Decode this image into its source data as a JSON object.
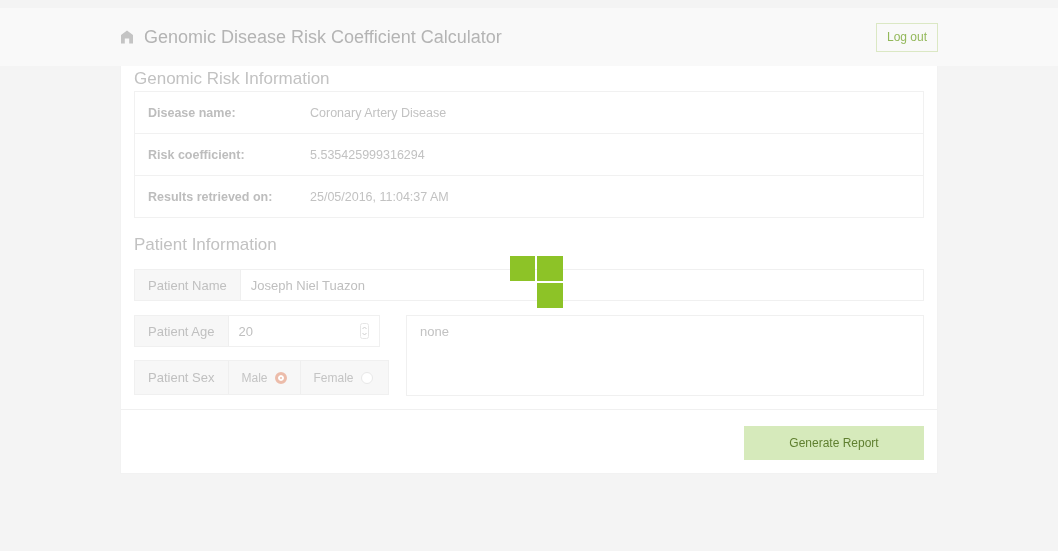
{
  "header": {
    "title": "Genomic Disease Risk Coefficient Calculator",
    "logout": "Log out"
  },
  "genomic_risk": {
    "heading": "Genomic Risk Information",
    "rows": [
      {
        "label": "Disease name:",
        "value": "Coronary Artery Disease"
      },
      {
        "label": "Risk coefficient:",
        "value": "5.535425999316294"
      },
      {
        "label": "Results retrieved on:",
        "value": "25/05/2016, 11:04:37 AM"
      }
    ]
  },
  "patient": {
    "heading": "Patient Information",
    "name": {
      "label": "Patient Name",
      "value": "Joseph Niel Tuazon"
    },
    "age": {
      "label": "Patient Age",
      "value": "20"
    },
    "sex": {
      "label": "Patient Sex",
      "options": [
        {
          "label": "Male",
          "selected": true
        },
        {
          "label": "Female",
          "selected": false
        }
      ]
    },
    "notes": {
      "value": "none"
    }
  },
  "generate_button": "Generate Report",
  "loading": true
}
